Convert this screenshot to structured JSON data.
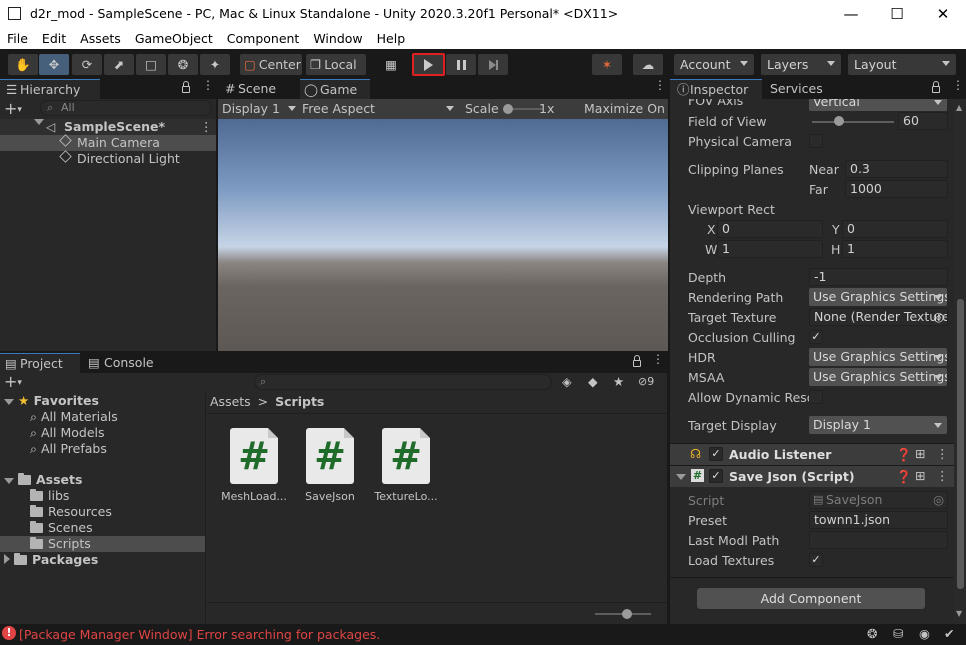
{
  "window": {
    "title": "d2r_mod - SampleScene - PC, Mac & Linux Standalone - Unity 2020.3.20f1 Personal* <DX11>"
  },
  "menu": [
    "File",
    "Edit",
    "Assets",
    "GameObject",
    "Component",
    "Window",
    "Help"
  ],
  "toolbar": {
    "pivot_label": "Center",
    "space_label": "Local",
    "account_label": "Account",
    "layers_label": "Layers",
    "layout_label": "Layout"
  },
  "hierarchy": {
    "tab_label": "Hierarchy",
    "search_placeholder": "All",
    "scene": "SampleScene*",
    "items": [
      "Main Camera",
      "Directional Light"
    ]
  },
  "game_view": {
    "tabs": [
      "Scene",
      "Game"
    ],
    "display": "Display 1",
    "aspect": "Free Aspect",
    "scale_label": "Scale",
    "scale_value": "1x",
    "maximize": "Maximize On P"
  },
  "project": {
    "tabs": [
      "Project",
      "Console"
    ],
    "badge_count": "9",
    "favorites_label": "Favorites",
    "favorites": [
      "All Materials",
      "All Models",
      "All Prefabs"
    ],
    "assets_label": "Assets",
    "folders": [
      "libs",
      "Resources",
      "Scenes",
      "Scripts"
    ],
    "packages_label": "Packages",
    "breadcrumb": {
      "root": "Assets",
      "current": "Scripts"
    },
    "files": [
      "MeshLoad...",
      "SaveJson",
      "TextureLo..."
    ]
  },
  "inspector": {
    "tabs": [
      "Inspector",
      "Services"
    ],
    "fov_axis": {
      "label": "FOV Axis",
      "value": "Vertical"
    },
    "field_of_view": {
      "label": "Field of View",
      "value": "60"
    },
    "physical_camera": {
      "label": "Physical Camera"
    },
    "clipping": {
      "label": "Clipping Planes",
      "near_label": "Near",
      "near": "0.3",
      "far_label": "Far",
      "far": "1000"
    },
    "viewport": {
      "label": "Viewport Rect",
      "x_label": "X",
      "x": "0",
      "y_label": "Y",
      "y": "0",
      "w_label": "W",
      "w": "1",
      "h_label": "H",
      "h": "1"
    },
    "depth": {
      "label": "Depth",
      "value": "-1"
    },
    "rendering_path": {
      "label": "Rendering Path",
      "value": "Use Graphics Settings"
    },
    "target_texture": {
      "label": "Target Texture",
      "value": "None (Render Texture)"
    },
    "occlusion": {
      "label": "Occlusion Culling"
    },
    "hdr": {
      "label": "HDR",
      "value": "Use Graphics Settings"
    },
    "msaa": {
      "label": "MSAA",
      "value": "Use Graphics Settings"
    },
    "dyn_res": {
      "label": "Allow Dynamic Resol"
    },
    "target_display": {
      "label": "Target Display",
      "value": "Display 1"
    },
    "audio_listener": "Audio Listener",
    "save_json": {
      "title": "Save Json (Script)",
      "script_label": "Script",
      "script_value": "SaveJson",
      "preset_label": "Preset",
      "preset_value": "townn1.json",
      "modl_label": "Last Modl Path",
      "modl_value": "",
      "load_label": "Load Textures"
    },
    "add_component": "Add Component"
  },
  "status": {
    "error": "[Package Manager Window] Error searching for packages.",
    "error_color": "#e04444"
  },
  "colors": {
    "play_highlight": "#e02020",
    "selection": "#2c5d87",
    "accent": "#3a79bb"
  }
}
